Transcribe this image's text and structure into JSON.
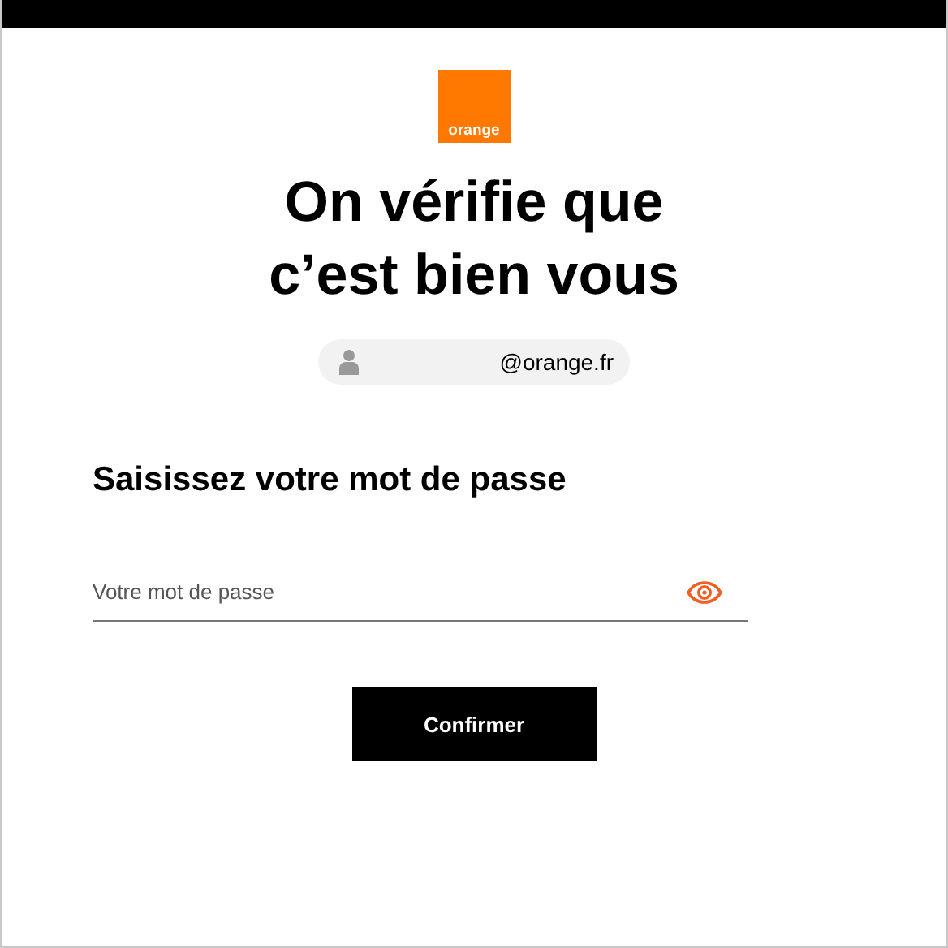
{
  "logo": {
    "text": "orange"
  },
  "title": "On vérifie que c’est bien vous",
  "account": {
    "email": "@orange.fr"
  },
  "heading": "Saisissez votre mot de passe",
  "password_field": {
    "placeholder": "Votre mot de passe"
  },
  "buttons": [
    {
      "label": "Confirmer"
    }
  ]
}
